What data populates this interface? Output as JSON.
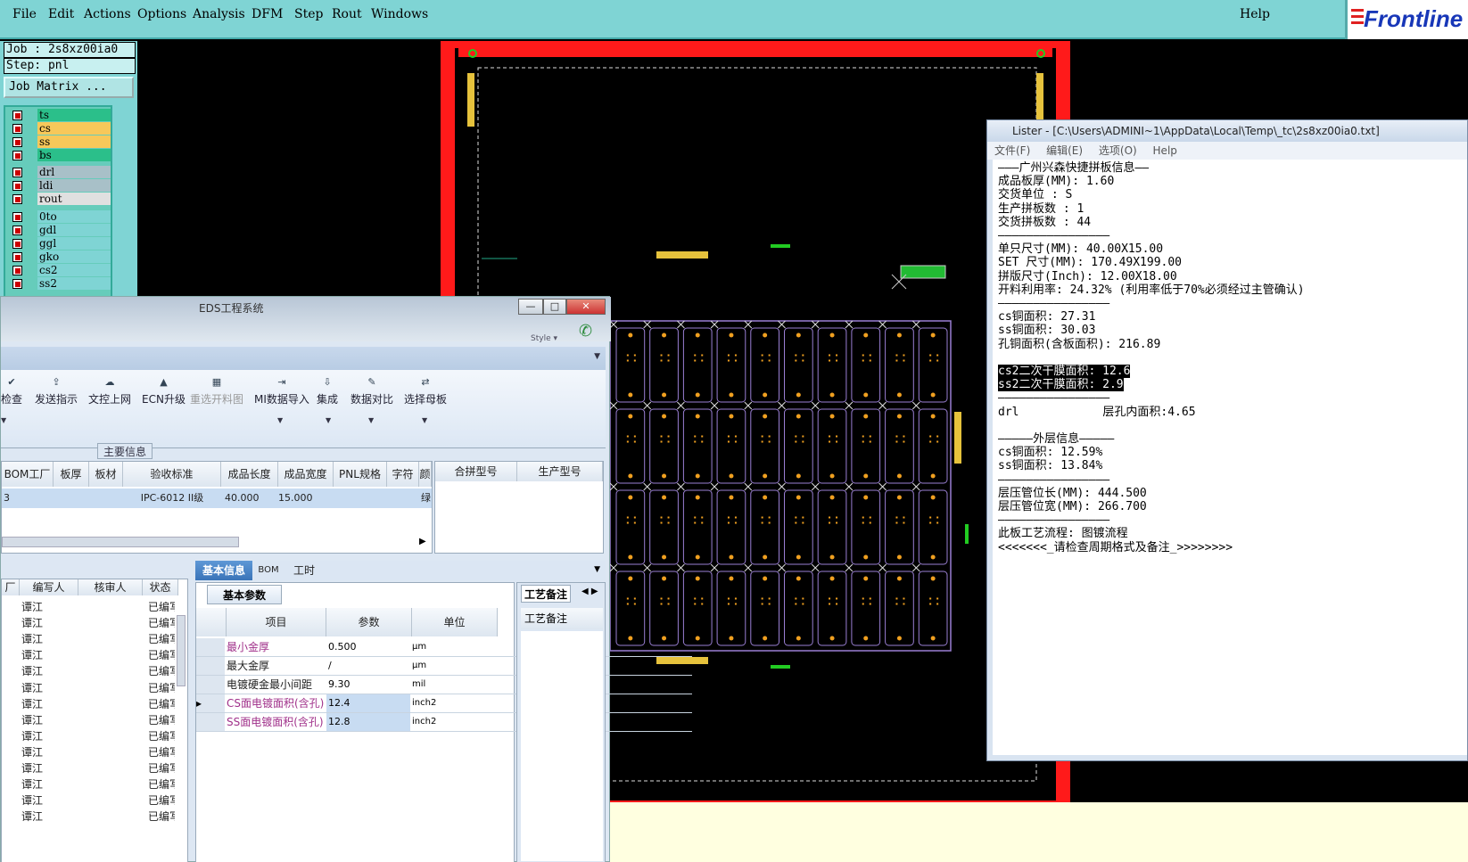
{
  "menubar": {
    "items": [
      "File",
      "Edit",
      "Actions",
      "Options",
      "Analysis",
      "DFM",
      "Step",
      "Rout",
      "Windows"
    ],
    "help": "Help",
    "logo": "Frontline"
  },
  "job": {
    "job_label": "Job : 2s8xz00ia0",
    "step_label": "Step: pnl",
    "matrix_button": "Job Matrix ..."
  },
  "layers": [
    {
      "name": "ts",
      "color": "#2bbf8a"
    },
    {
      "name": "cs",
      "color": "#f7c85a"
    },
    {
      "name": "ss",
      "color": "#f7c85a"
    },
    {
      "name": "bs",
      "color": "#2bbf8a"
    },
    {
      "name": "drl",
      "color": "#a8c0c8"
    },
    {
      "name": "ldi",
      "color": "#a8c0c8"
    },
    {
      "name": "rout",
      "color": "#e0e0e0"
    },
    {
      "name": "0to",
      "color": "#7fd4d4"
    },
    {
      "name": "gdl",
      "color": "#7fd4d4"
    },
    {
      "name": "ggl",
      "color": "#7fd4d4"
    },
    {
      "name": "gko",
      "color": "#7fd4d4"
    },
    {
      "name": "cs2",
      "color": "#7fd4d4"
    },
    {
      "name": "ss2",
      "color": "#7fd4d4"
    }
  ],
  "lister": {
    "title": "Lister - [C:\\Users\\ADMINI~1\\AppData\\Local\\Temp\\_tc\\2s8xz00ia0.txt]",
    "menu": [
      "文件(F)",
      "编辑(E)",
      "选项(O)",
      "Help"
    ],
    "lines": [
      "———广州兴森快捷拼板信息——",
      "成品板厚(MM): 1.60",
      "交货单位 : S",
      "生产拼板数 : 1",
      "交货拼板数 : 44",
      "————————————————",
      "单只尺寸(MM): 40.00X15.00",
      "SET 尺寸(MM): 170.49X199.00",
      "拼版尺寸(Inch): 12.00X18.00",
      "开料利用率: 24.32% (利用率低于70%必须经过主管确认)",
      "————————————————",
      "cs铜面积: 27.31",
      "ss铜面积: 30.03",
      "孔铜面积(含板面积): 216.89",
      "",
      "cs2二次干膜面积: 12.6",
      "ss2二次干膜面积: 2.9",
      "————————————————",
      "drl            层孔内面积:4.65",
      "",
      "—————外层信息—————",
      "cs铜面积: 12.59%",
      "ss铜面积: 13.84%",
      "————————————————",
      "层压管位长(MM): 444.500",
      "层压管位宽(MM): 266.700",
      "————————————————",
      "此板工艺流程: 图镀流程",
      "<<<<<<<_请检查周期格式及备注_>>>>>>>>"
    ]
  },
  "eds": {
    "title": "EDS工程系统",
    "style_label": "Style ▾",
    "ribbon": [
      {
        "label": "检查",
        "disabled": false
      },
      {
        "label": "发送指示",
        "disabled": false
      },
      {
        "label": "文控上网",
        "disabled": false
      },
      {
        "label": "ECN升级",
        "disabled": false
      },
      {
        "label": "重选开料图",
        "disabled": true
      },
      {
        "label": "MI数据导入",
        "disabled": false
      },
      {
        "label": "集成",
        "disabled": false
      },
      {
        "label": "数据对比",
        "disabled": false
      },
      {
        "label": "选择母板",
        "disabled": false
      }
    ],
    "group_label": "主要信息",
    "main_grid": {
      "headers": [
        "BOM工厂",
        "板厚",
        "板材",
        "验收标准",
        "成品长度",
        "成品宽度",
        "PNL规格",
        "字符",
        "颜"
      ],
      "row": [
        "3",
        "",
        "",
        "IPC-6012 II级",
        "40.000",
        "15.000",
        "",
        "",
        "绿"
      ]
    },
    "side_grid": {
      "headers": [
        "合拼型号",
        "生产型号"
      ]
    },
    "list": {
      "headers": [
        "厂",
        "编写人",
        "核审人",
        "状态"
      ],
      "rows": [
        {
          "writer": "谭江",
          "status": "已编写"
        },
        {
          "writer": "谭江",
          "status": "已编写"
        },
        {
          "writer": "谭江",
          "status": "已编写"
        },
        {
          "writer": "谭江",
          "status": "已编写"
        },
        {
          "writer": "谭江",
          "status": "已编写"
        },
        {
          "writer": "谭江",
          "status": "已编写"
        },
        {
          "writer": "谭江",
          "status": "已编写"
        },
        {
          "writer": "谭江",
          "status": "已编写"
        },
        {
          "writer": "谭江",
          "status": "已编写"
        },
        {
          "writer": "谭江",
          "status": "已编写"
        },
        {
          "writer": "谭江",
          "status": "已编写"
        },
        {
          "writer": "谭江",
          "status": "已编写"
        },
        {
          "writer": "谭江",
          "status": "已编写"
        },
        {
          "writer": "谭江",
          "status": "已编写"
        }
      ]
    },
    "tabs": [
      "基本信息",
      "BOM",
      "工时"
    ],
    "subtab": "基本参数",
    "params": {
      "headers": [
        "项目",
        "参数",
        "单位"
      ],
      "rows": [
        {
          "item": "最小金厚",
          "value": "0.500",
          "unit": "μm",
          "pink": true
        },
        {
          "item": "最大金厚",
          "value": "/",
          "unit": "μm",
          "pink": false
        },
        {
          "item": "电镀硬金最小间距",
          "value": "9.30",
          "unit": "mil",
          "pink": false
        },
        {
          "item": "CS面电镀面积(含孔)",
          "value": "12.4",
          "unit": "inch2",
          "pink": true
        },
        {
          "item": "SS面电镀面积(含孔)",
          "value": "12.8",
          "unit": "inch2",
          "pink": true
        }
      ]
    },
    "remark_tab": "工艺备注",
    "remark_header": "工艺备注"
  },
  "colors": {
    "menubar": "#7fd4d4",
    "frame_red": "#ff1a1a",
    "outline_purple": "#9a7fd4",
    "pad_orange": "#f0a020"
  }
}
